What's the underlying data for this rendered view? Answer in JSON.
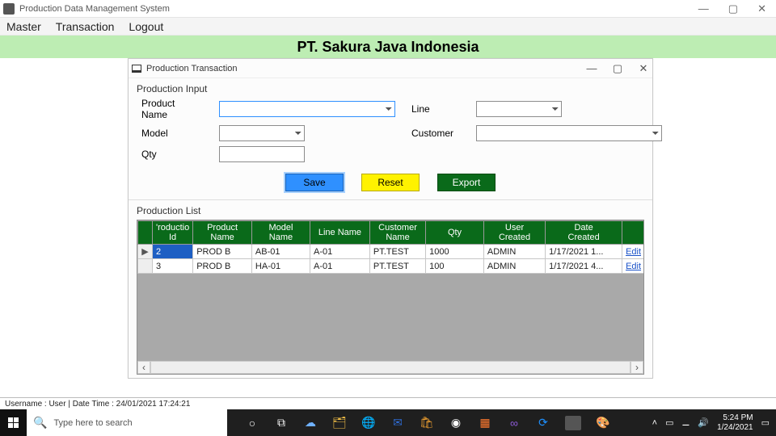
{
  "app": {
    "title": "Production Data Management System"
  },
  "menubar": {
    "items": [
      "Master",
      "Transaction",
      "Logout"
    ]
  },
  "banner": {
    "company": "PT. Sakura Java Indonesia"
  },
  "dialog": {
    "title": "Production Transaction",
    "group_input_label": "Production Input",
    "group_list_label": "Production List",
    "labels": {
      "product_name": "Product Name",
      "line": "Line",
      "model": "Model",
      "customer": "Customer",
      "qty": "Qty"
    },
    "buttons": {
      "save": "Save",
      "reset": "Reset",
      "export": "Export"
    },
    "columns": [
      "Production Id",
      "Product Name",
      "Model Name",
      "Line Name",
      "Customer Name",
      "Qty",
      "User Created",
      "Date Created",
      ""
    ],
    "column_display": [
      "roductio\nId",
      "Product\nName",
      "Model\nName",
      "Line Name",
      "Customer\nName",
      "Qty",
      "User\nCreated",
      "Date\nCreated",
      ""
    ],
    "rows": [
      {
        "row_marker": "▶",
        "id": "2",
        "product": "PROD B",
        "model": "AB-01",
        "line": "A-01",
        "customer": "PT.TEST",
        "qty": "1000",
        "user": "ADMIN",
        "date": "1/17/2021 1...",
        "action": "Edit"
      },
      {
        "row_marker": "",
        "id": "3",
        "product": "PROD B",
        "model": "HA-01",
        "line": "A-01",
        "customer": "PT.TEST",
        "qty": "100",
        "user": "ADMIN",
        "date": "1/17/2021 4...",
        "action": "Edit"
      }
    ]
  },
  "statusbar": {
    "text": "Username :  User   |   Date Time :   24/01/2021 17:24:21"
  },
  "taskbar": {
    "search_placeholder": "Type here to search",
    "time": "5:24 PM",
    "date": "1/24/2021"
  }
}
